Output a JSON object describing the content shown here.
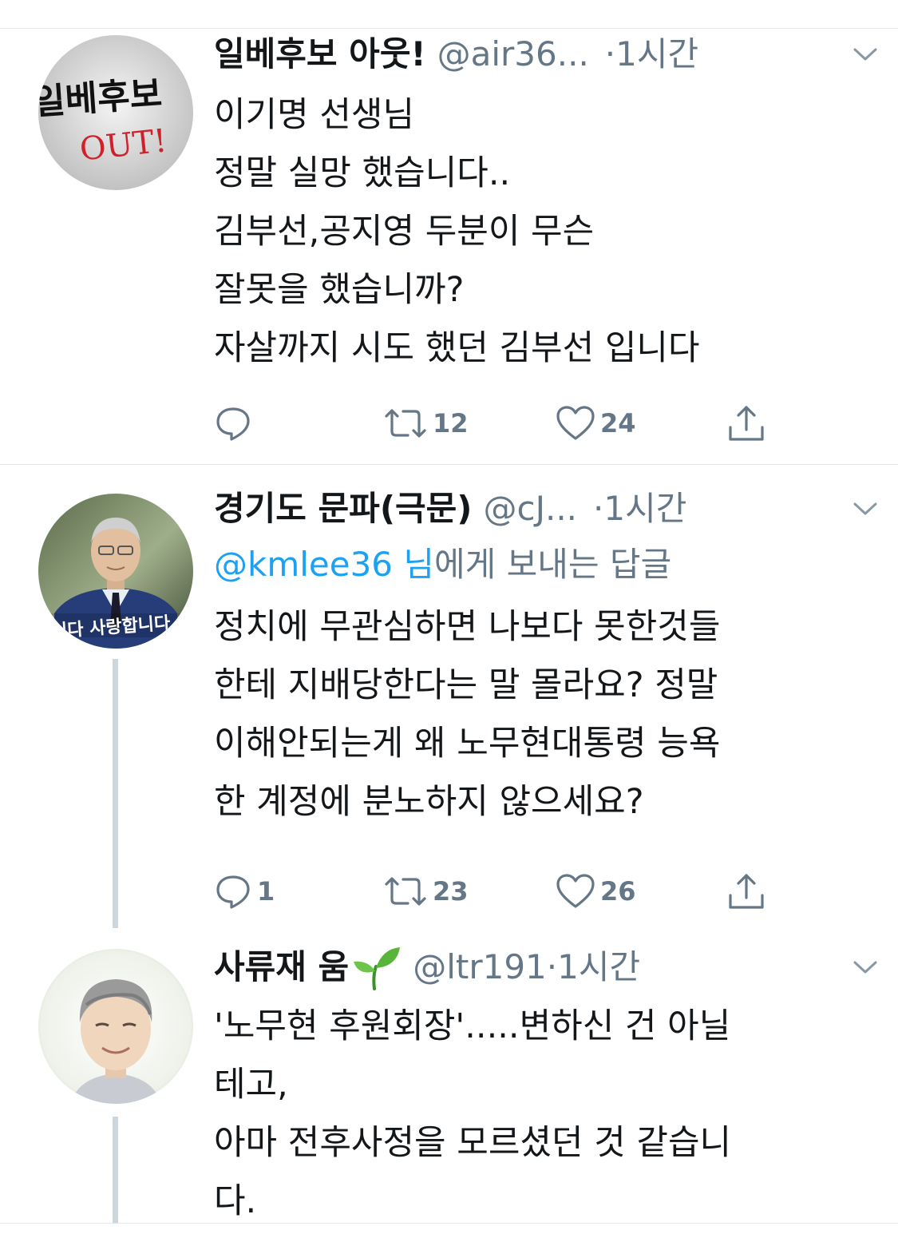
{
  "tweets": [
    {
      "avatar_text": [
        "일베후보",
        "OUT!"
      ],
      "display_name": "일베후보 아웃!",
      "handle": "@air36...",
      "time_sep": "·",
      "time": "1시간",
      "lines": [
        "이기명 선생님",
        "정말 실망 했습니다..",
        "김부선,공지영 두분이 무슨",
        "잘못을 했습니까?",
        "자살까지 시도 했던 김부선 입니다"
      ],
      "replies": "",
      "retweets": "12",
      "likes": "24"
    },
    {
      "avatar_text": "습니다 사랑합니다",
      "display_name": "경기도 문파(극문)",
      "handle": "@cJ...",
      "time_sep": "·",
      "time": "1시간",
      "replying_mention": "@kmlee36 님",
      "replying_suffix": "에게 보내는 답글",
      "lines": [
        "정치에 무관심하면 나보다 못한것들",
        "한테 지배당한다는 말 몰라요? 정말",
        "이해안되는게 왜 노무현대통령 능욕",
        "한 계정에 분노하지 않으세요?"
      ],
      "replies": "1",
      "retweets": "23",
      "likes": "26"
    },
    {
      "display_name": "사류재 움",
      "handle": "@ltr191",
      "time_sep": "·",
      "time": "1시간",
      "lines": [
        "'노무현 후원회장'.....변하신 건 아닐",
        "테고,",
        "아마 전후사정을 모르셨던 것 같습니",
        "다."
      ]
    }
  ],
  "colors": {
    "text": "#14171a",
    "secondary": "#657786",
    "link": "#1da1f2",
    "divider": "#e1e8ed",
    "thread_line": "#ccd6dd"
  },
  "icons": [
    "reply-icon",
    "retweet-icon",
    "like-icon",
    "share-icon",
    "caret-down-icon",
    "sprout-emoji"
  ]
}
